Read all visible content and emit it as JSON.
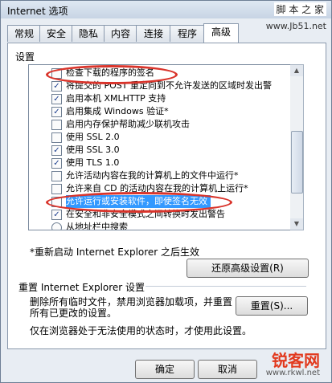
{
  "window": {
    "title": "Internet 选项",
    "watermark_top": "脚 本 之 家",
    "watermark_site": "www.Jb51.net"
  },
  "tabs": [
    "常规",
    "安全",
    "隐私",
    "内容",
    "连接",
    "程序",
    "高级"
  ],
  "active_tab": 6,
  "settings_label": "设置",
  "settings_items": [
    {
      "label": "检查下载的程序的签名",
      "checked": false
    },
    {
      "label": "将提交的 POST 重定向到不允许发送的区域时发出警",
      "checked": true
    },
    {
      "label": "启用本机 XMLHTTP 支持",
      "checked": true
    },
    {
      "label": "启用集成 Windows 验证*",
      "checked": true
    },
    {
      "label": "启用内存保护帮助减少联机攻击",
      "checked": false
    },
    {
      "label": "使用 SSL 2.0",
      "checked": false
    },
    {
      "label": "使用 SSL 3.0",
      "checked": true
    },
    {
      "label": "使用 TLS 1.0",
      "checked": true
    },
    {
      "label": "允许活动内容在我的计算机上的文件中运行*",
      "checked": false
    },
    {
      "label": "允许来自 CD 的活动内容在我的计算机上运行*",
      "checked": false
    },
    {
      "label": "允许运行或安装软件，即使签名无效",
      "checked": false,
      "selected": true
    },
    {
      "label": "在安全和非安全模式之间转换时发出警告",
      "checked": true
    },
    {
      "label": "从地址栏中搜索",
      "radio": true
    }
  ],
  "note": "*重新启动 Internet Explorer 之后生效",
  "restore_button": "还原高级设置(R)",
  "reset_section_label": "重置 Internet Explorer 设置",
  "reset_desc_line1": "删除所有临时文件，禁用浏览器加载项，并重置",
  "reset_desc_line2": "所有已更改的设置。",
  "reset_button": "重置(S)...",
  "reset_hint": "仅在浏览器处于无法使用的状态时，才使用此设置。",
  "buttons": {
    "ok": "确定",
    "cancel": "取消"
  },
  "brand_watermark": "锐客网",
  "brand_url": "www.rkwl.net"
}
